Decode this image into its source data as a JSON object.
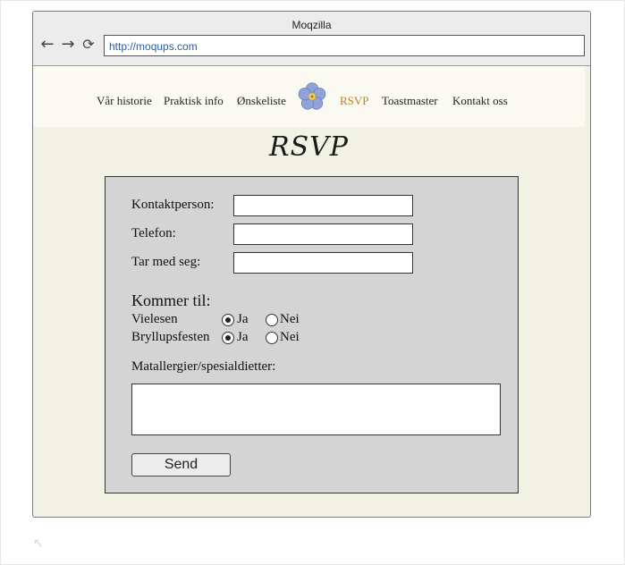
{
  "window": {
    "title": "Moqzilla",
    "url": "http://moqups.com"
  },
  "icons": {
    "back": "arrow-left-icon",
    "forward": "arrow-right-icon",
    "reload": "reload-icon",
    "logo": "forget-me-not-flower",
    "resize": "resize-handle-icon"
  },
  "nav": {
    "items": [
      "Vår historie",
      "Praktisk info",
      "Ønskeliste",
      "RSVP",
      "Toastmaster",
      "Kontakt oss"
    ],
    "active": "RSVP",
    "active_color": "#b5832b"
  },
  "page": {
    "title": "RSVP"
  },
  "form": {
    "fields": [
      {
        "label": "Kontaktperson:",
        "value": ""
      },
      {
        "label": "Telefon:",
        "value": ""
      },
      {
        "label": "Tar med seg:",
        "value": ""
      }
    ],
    "attending_title": "Kommer til:",
    "events": [
      {
        "label": "Vielesen",
        "yes": "Ja",
        "no": "Nei",
        "selected": "Ja"
      },
      {
        "label": "Bryllupsfesten",
        "yes": "Ja",
        "no": "Nei",
        "selected": "Ja"
      }
    ],
    "allergies_label": "Matallergier/spesialdietter:",
    "allergies_value": "",
    "submit_label": "Send"
  }
}
